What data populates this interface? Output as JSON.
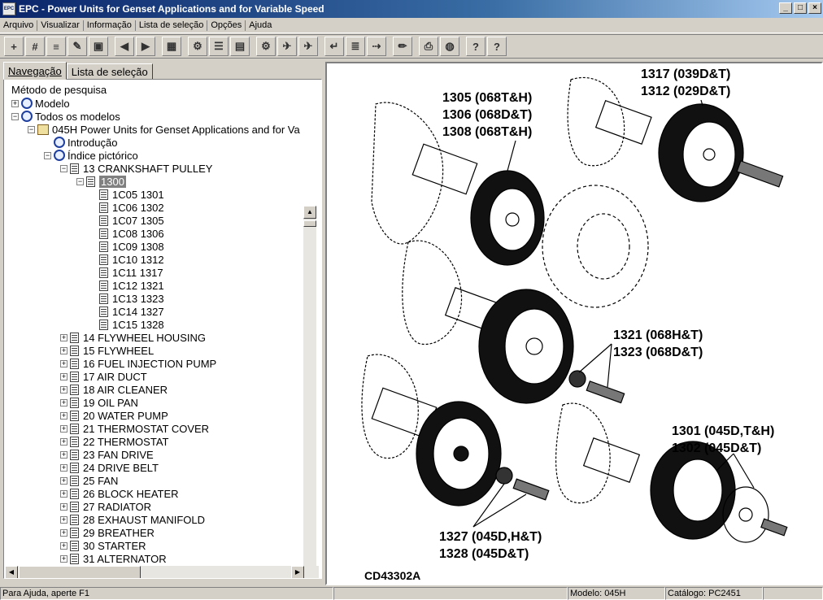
{
  "window": {
    "app_icon": "EPC",
    "title": "EPC - Power Units for Genset Applications and for Variable Speed",
    "buttons": [
      "_",
      "□",
      "×"
    ]
  },
  "menu": [
    "Arquivo",
    "Visualizar",
    "Informação",
    "Lista de seleção",
    "Opções",
    "Ajuda"
  ],
  "toolbar": {
    "icons": [
      "tree-add-icon",
      "hash-icon",
      "tray-icon",
      "edit-note-icon",
      "screen-icon",
      "back-arrow-icon",
      "forward-arrow-icon",
      "grid-icon",
      "gear-page-icon",
      "note-icon",
      "page-icon",
      "settings-icon",
      "run-icon",
      "run-alt-icon",
      "return-icon",
      "list-icon",
      "export-icon",
      "pencil-icon",
      "print-icon",
      "globe-icon",
      "help-icon",
      "context-help-icon"
    ],
    "glyphs": [
      "+",
      "#",
      "≡",
      "✎",
      "▣",
      "◀",
      "▶",
      "▦",
      "⚙",
      "☰",
      "▤",
      "⚙",
      "✈",
      "✈",
      "↵",
      "≣",
      "⇢",
      "✏",
      "⎙",
      "◍",
      "?",
      "?‍"
    ]
  },
  "nav": {
    "tabs": [
      "Navegação",
      "Lista de seleção"
    ],
    "tree_header": "Método de pesquisa",
    "tree": [
      {
        "label": "Modelo",
        "depth": 0,
        "expander": "+",
        "icon": "mag"
      },
      {
        "label": "Todos os modelos",
        "depth": 0,
        "expander": "−",
        "icon": "mag"
      },
      {
        "label": "045H  Power Units for Genset Applications and for Va",
        "depth": 1,
        "expander": "−",
        "icon": "book"
      },
      {
        "label": "Introdução",
        "depth": 2,
        "expander": "",
        "icon": "mag"
      },
      {
        "label": "Índice pictórico",
        "depth": 2,
        "expander": "−",
        "icon": "mag"
      },
      {
        "label": "13  CRANKSHAFT PULLEY",
        "depth": 3,
        "expander": "−",
        "icon": "page"
      },
      {
        "label": "1300",
        "depth": 4,
        "expander": "−",
        "icon": "page",
        "selected": true
      },
      {
        "label": "1C05  1301",
        "depth": 5,
        "expander": "",
        "icon": "page"
      },
      {
        "label": "1C06  1302",
        "depth": 5,
        "expander": "",
        "icon": "page"
      },
      {
        "label": "1C07  1305",
        "depth": 5,
        "expander": "",
        "icon": "page"
      },
      {
        "label": "1C08  1306",
        "depth": 5,
        "expander": "",
        "icon": "page"
      },
      {
        "label": "1C09  1308",
        "depth": 5,
        "expander": "",
        "icon": "page"
      },
      {
        "label": "1C10  1312",
        "depth": 5,
        "expander": "",
        "icon": "page"
      },
      {
        "label": "1C11  1317",
        "depth": 5,
        "expander": "",
        "icon": "page"
      },
      {
        "label": "1C12  1321",
        "depth": 5,
        "expander": "",
        "icon": "page"
      },
      {
        "label": "1C13  1323",
        "depth": 5,
        "expander": "",
        "icon": "page"
      },
      {
        "label": "1C14  1327",
        "depth": 5,
        "expander": "",
        "icon": "page"
      },
      {
        "label": "1C15  1328",
        "depth": 5,
        "expander": "",
        "icon": "page"
      },
      {
        "label": "14  FLYWHEEL HOUSING",
        "depth": 3,
        "expander": "+",
        "icon": "page"
      },
      {
        "label": "15  FLYWHEEL",
        "depth": 3,
        "expander": "+",
        "icon": "page"
      },
      {
        "label": "16  FUEL INJECTION PUMP",
        "depth": 3,
        "expander": "+",
        "icon": "page"
      },
      {
        "label": "17  AIR DUCT",
        "depth": 3,
        "expander": "+",
        "icon": "page"
      },
      {
        "label": "18  AIR CLEANER",
        "depth": 3,
        "expander": "+",
        "icon": "page"
      },
      {
        "label": "19  OIL PAN",
        "depth": 3,
        "expander": "+",
        "icon": "page"
      },
      {
        "label": "20  WATER PUMP",
        "depth": 3,
        "expander": "+",
        "icon": "page"
      },
      {
        "label": "21  THERMOSTAT COVER",
        "depth": 3,
        "expander": "+",
        "icon": "page"
      },
      {
        "label": "22  THERMOSTAT",
        "depth": 3,
        "expander": "+",
        "icon": "page"
      },
      {
        "label": "23  FAN DRIVE",
        "depth": 3,
        "expander": "+",
        "icon": "page"
      },
      {
        "label": "24  DRIVE BELT",
        "depth": 3,
        "expander": "+",
        "icon": "page"
      },
      {
        "label": "25  FAN",
        "depth": 3,
        "expander": "+",
        "icon": "page"
      },
      {
        "label": "26  BLOCK HEATER",
        "depth": 3,
        "expander": "+",
        "icon": "page"
      },
      {
        "label": "27  RADIATOR",
        "depth": 3,
        "expander": "+",
        "icon": "page"
      },
      {
        "label": "28  EXHAUST MANIFOLD",
        "depth": 3,
        "expander": "+",
        "icon": "page"
      },
      {
        "label": "29  BREATHER",
        "depth": 3,
        "expander": "+",
        "icon": "page"
      },
      {
        "label": "30  STARTER",
        "depth": 3,
        "expander": "+",
        "icon": "page"
      },
      {
        "label": "31  ALTERNATOR",
        "depth": 3,
        "expander": "+",
        "icon": "page"
      }
    ],
    "scroll_arrows": {
      "up": "▲",
      "down": "▼",
      "left": "◀",
      "right": "▶"
    }
  },
  "diagram": {
    "callouts": [
      {
        "lines": [
          "1317 (039D&T)",
          "1312 (029D&T)"
        ]
      },
      {
        "lines": [
          "1305 (068T&H)",
          "1306 (068D&T)",
          "1308 (068T&H)"
        ]
      },
      {
        "lines": [
          "1321 (068H&T)",
          "1323 (068D&T)"
        ]
      },
      {
        "lines": [
          "1301 (045D,T&H)",
          "1302 (045D&T)"
        ]
      },
      {
        "lines": [
          "1327 (045D,H&T)",
          "1328 (045D&T)"
        ]
      }
    ],
    "drawing_id": "CD43302A"
  },
  "status": {
    "help": "Para Ajuda, aperte F1",
    "empty": "",
    "model": "Modelo: 045H",
    "catalog": "Catálogo: PC2451"
  }
}
